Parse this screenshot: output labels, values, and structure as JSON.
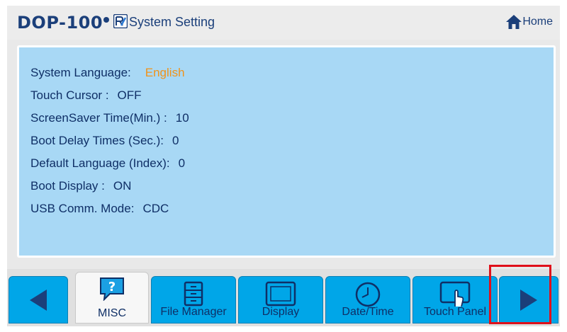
{
  "header": {
    "brand": "DOP-100",
    "title": "System Setting",
    "home_label": "Home"
  },
  "settings": [
    {
      "label": "System Language:",
      "value": "English",
      "accent": true
    },
    {
      "label": "Touch Cursor :",
      "value": "OFF",
      "accent": false
    },
    {
      "label": "ScreenSaver Time(Min.) :",
      "value": "10",
      "accent": false
    },
    {
      "label": "Boot Delay Times (Sec.):",
      "value": "0",
      "accent": false
    },
    {
      "label": "Default Language (Index):",
      "value": "0",
      "accent": false
    },
    {
      "label": "Boot Display :",
      "value": "ON",
      "accent": false
    },
    {
      "label": "USB Comm. Mode:",
      "value": "CDC",
      "accent": false
    }
  ],
  "tabs": [
    {
      "label": "MISC",
      "icon": "question-icon",
      "active": true
    },
    {
      "label": "File Manager",
      "icon": "file-cabinet-icon",
      "active": false
    },
    {
      "label": "Display",
      "icon": "monitor-icon",
      "active": false
    },
    {
      "label": "Date/Time",
      "icon": "clock-icon",
      "active": false
    },
    {
      "label": "Touch Panel",
      "icon": "touch-hand-icon",
      "active": false
    }
  ],
  "colors": {
    "panel_bg": "#a8d8f5",
    "tab_bg": "#00a6e8",
    "text_dark_blue": "#0f2f66",
    "accent_orange": "#f0931a",
    "highlight_red": "#e0101a"
  }
}
